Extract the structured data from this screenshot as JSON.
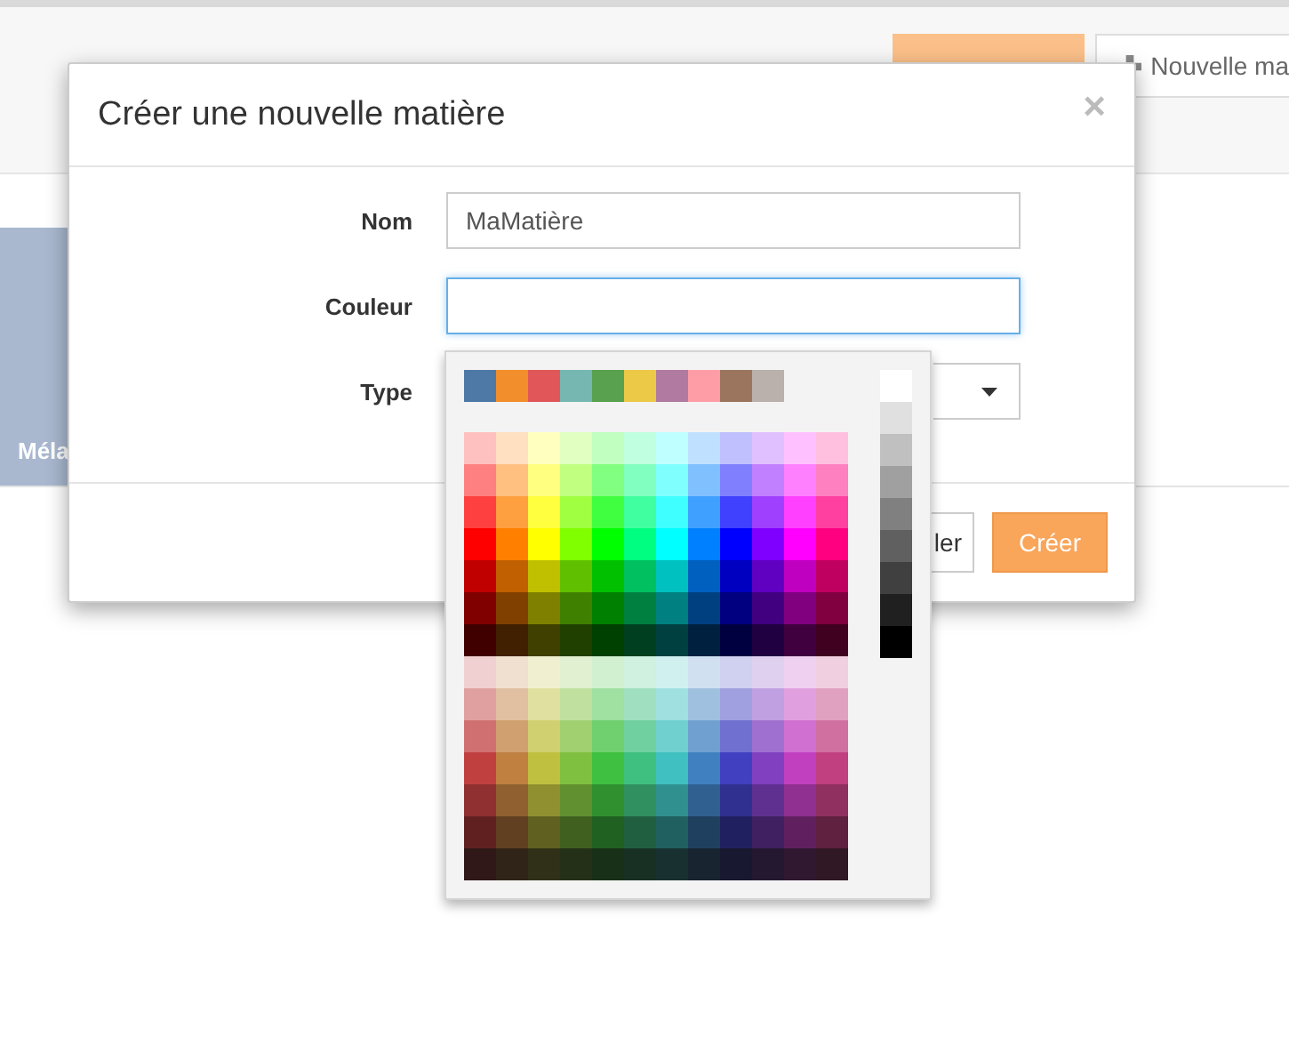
{
  "toolbar": {
    "new_button": "Nouvelle ma"
  },
  "card": {
    "label": "Méla"
  },
  "dialog": {
    "title": "Créer une nouvelle matière",
    "close": "×",
    "fields": [
      {
        "label": "Nom",
        "value": "MaMatière",
        "focused": false,
        "kind": "text"
      },
      {
        "label": "Couleur",
        "focused": true,
        "kind": "text"
      },
      {
        "label": "Type",
        "kind": "select"
      }
    ],
    "cancel_button": "ler",
    "create_button": "Créer"
  },
  "palette": {
    "top": [
      {
        "color": "#4e79a7"
      },
      {
        "color": "#f28e2b"
      },
      {
        "color": "#e15759"
      },
      {
        "color": "#76b7b2"
      },
      {
        "color": "#59a14f"
      },
      {
        "color": "#edc948"
      },
      {
        "color": "#b07aa1"
      },
      {
        "color": "#ff9da7"
      },
      {
        "color": "#9c755f"
      },
      {
        "color": "#bab0ac"
      }
    ],
    "grays": [
      {
        "color": "#ffffff"
      },
      {
        "color": "#e0e0e0"
      },
      {
        "color": "#c0c0c0"
      },
      {
        "color": "#a0a0a0"
      },
      {
        "color": "#808080"
      },
      {
        "color": "#606060"
      },
      {
        "color": "#404040"
      },
      {
        "color": "#202020"
      },
      {
        "color": "#000000"
      }
    ],
    "grid": [
      {
        "swatches": [
          {
            "color": "#ffc0c0"
          },
          {
            "color": "#ffe0c0"
          },
          {
            "color": "#ffffc0"
          },
          {
            "color": "#e0ffc0"
          },
          {
            "color": "#c0ffc0"
          },
          {
            "color": "#c0ffe0"
          },
          {
            "color": "#c0ffff"
          },
          {
            "color": "#c0e0ff"
          },
          {
            "color": "#c0c0ff"
          },
          {
            "color": "#e0c0ff"
          },
          {
            "color": "#ffc0ff"
          },
          {
            "color": "#ffc0e0"
          }
        ]
      },
      {
        "swatches": [
          {
            "color": "#ff8080"
          },
          {
            "color": "#ffc080"
          },
          {
            "color": "#ffff80"
          },
          {
            "color": "#c0ff80"
          },
          {
            "color": "#80ff80"
          },
          {
            "color": "#80ffc0"
          },
          {
            "color": "#80ffff"
          },
          {
            "color": "#80c0ff"
          },
          {
            "color": "#8080ff"
          },
          {
            "color": "#c080ff"
          },
          {
            "color": "#ff80ff"
          },
          {
            "color": "#ff80c0"
          }
        ]
      },
      {
        "swatches": [
          {
            "color": "#ff4040"
          },
          {
            "color": "#ffa040"
          },
          {
            "color": "#ffff40"
          },
          {
            "color": "#a0ff40"
          },
          {
            "color": "#40ff40"
          },
          {
            "color": "#40ffa0"
          },
          {
            "color": "#40ffff"
          },
          {
            "color": "#40a0ff"
          },
          {
            "color": "#4040ff"
          },
          {
            "color": "#a040ff"
          },
          {
            "color": "#ff40ff"
          },
          {
            "color": "#ff40a0"
          }
        ]
      },
      {
        "swatches": [
          {
            "color": "#ff0000"
          },
          {
            "color": "#ff8000"
          },
          {
            "color": "#ffff00"
          },
          {
            "color": "#80ff00"
          },
          {
            "color": "#00ff00"
          },
          {
            "color": "#00ff80"
          },
          {
            "color": "#00ffff"
          },
          {
            "color": "#0080ff"
          },
          {
            "color": "#0000ff"
          },
          {
            "color": "#8000ff"
          },
          {
            "color": "#ff00ff"
          },
          {
            "color": "#ff0080"
          }
        ]
      },
      {
        "swatches": [
          {
            "color": "#c00000"
          },
          {
            "color": "#c06000"
          },
          {
            "color": "#c0c000"
          },
          {
            "color": "#60c000"
          },
          {
            "color": "#00c000"
          },
          {
            "color": "#00c060"
          },
          {
            "color": "#00c0c0"
          },
          {
            "color": "#0060c0"
          },
          {
            "color": "#0000c0"
          },
          {
            "color": "#6000c0"
          },
          {
            "color": "#c000c0"
          },
          {
            "color": "#c00060"
          }
        ]
      },
      {
        "swatches": [
          {
            "color": "#800000"
          },
          {
            "color": "#804000"
          },
          {
            "color": "#808000"
          },
          {
            "color": "#408000"
          },
          {
            "color": "#008000"
          },
          {
            "color": "#008040"
          },
          {
            "color": "#008080"
          },
          {
            "color": "#004080"
          },
          {
            "color": "#000080"
          },
          {
            "color": "#400080"
          },
          {
            "color": "#800080"
          },
          {
            "color": "#800040"
          }
        ]
      },
      {
        "swatches": [
          {
            "color": "#400000"
          },
          {
            "color": "#402000"
          },
          {
            "color": "#404000"
          },
          {
            "color": "#204000"
          },
          {
            "color": "#004000"
          },
          {
            "color": "#004020"
          },
          {
            "color": "#004040"
          },
          {
            "color": "#002040"
          },
          {
            "color": "#000040"
          },
          {
            "color": "#200040"
          },
          {
            "color": "#400040"
          },
          {
            "color": "#400020"
          }
        ]
      },
      {
        "swatches": [
          {
            "color": "#f0d0d0"
          },
          {
            "color": "#f0e0d0"
          },
          {
            "color": "#f0f0d0"
          },
          {
            "color": "#e0f0d0"
          },
          {
            "color": "#d0f0d0"
          },
          {
            "color": "#d0f0e0"
          },
          {
            "color": "#d0f0f0"
          },
          {
            "color": "#d0e0f0"
          },
          {
            "color": "#d0d0f0"
          },
          {
            "color": "#e0d0f0"
          },
          {
            "color": "#f0d0f0"
          },
          {
            "color": "#f0d0e0"
          }
        ]
      },
      {
        "swatches": [
          {
            "color": "#e0a0a0"
          },
          {
            "color": "#e0c0a0"
          },
          {
            "color": "#e0e0a0"
          },
          {
            "color": "#c0e0a0"
          },
          {
            "color": "#a0e0a0"
          },
          {
            "color": "#a0e0c0"
          },
          {
            "color": "#a0e0e0"
          },
          {
            "color": "#a0c0e0"
          },
          {
            "color": "#a0a0e0"
          },
          {
            "color": "#c0a0e0"
          },
          {
            "color": "#e0a0e0"
          },
          {
            "color": "#e0a0c0"
          }
        ]
      },
      {
        "swatches": [
          {
            "color": "#d07070"
          },
          {
            "color": "#d0a070"
          },
          {
            "color": "#d0d070"
          },
          {
            "color": "#a0d070"
          },
          {
            "color": "#70d070"
          },
          {
            "color": "#70d0a0"
          },
          {
            "color": "#70d0d0"
          },
          {
            "color": "#70a0d0"
          },
          {
            "color": "#7070d0"
          },
          {
            "color": "#a070d0"
          },
          {
            "color": "#d070d0"
          },
          {
            "color": "#d070a0"
          }
        ]
      },
      {
        "swatches": [
          {
            "color": "#c04040"
          },
          {
            "color": "#c08040"
          },
          {
            "color": "#c0c040"
          },
          {
            "color": "#80c040"
          },
          {
            "color": "#40c040"
          },
          {
            "color": "#40c080"
          },
          {
            "color": "#40c0c0"
          },
          {
            "color": "#4080c0"
          },
          {
            "color": "#4040c0"
          },
          {
            "color": "#8040c0"
          },
          {
            "color": "#c040c0"
          },
          {
            "color": "#c04080"
          }
        ]
      },
      {
        "swatches": [
          {
            "color": "#903030"
          },
          {
            "color": "#906030"
          },
          {
            "color": "#909030"
          },
          {
            "color": "#609030"
          },
          {
            "color": "#309030"
          },
          {
            "color": "#309060"
          },
          {
            "color": "#309090"
          },
          {
            "color": "#306090"
          },
          {
            "color": "#303090"
          },
          {
            "color": "#603090"
          },
          {
            "color": "#903090"
          },
          {
            "color": "#903060"
          }
        ]
      },
      {
        "swatches": [
          {
            "color": "#602020"
          },
          {
            "color": "#604020"
          },
          {
            "color": "#606020"
          },
          {
            "color": "#406020"
          },
          {
            "color": "#206020"
          },
          {
            "color": "#206040"
          },
          {
            "color": "#206060"
          },
          {
            "color": "#204060"
          },
          {
            "color": "#202060"
          },
          {
            "color": "#402060"
          },
          {
            "color": "#602060"
          },
          {
            "color": "#602040"
          }
        ]
      },
      {
        "swatches": [
          {
            "color": "#301818"
          },
          {
            "color": "#302418"
          },
          {
            "color": "#303018"
          },
          {
            "color": "#243018"
          },
          {
            "color": "#183018"
          },
          {
            "color": "#183024"
          },
          {
            "color": "#183030"
          },
          {
            "color": "#182430"
          },
          {
            "color": "#181830"
          },
          {
            "color": "#241830"
          },
          {
            "color": "#301830"
          },
          {
            "color": "#301824"
          }
        ]
      }
    ]
  }
}
